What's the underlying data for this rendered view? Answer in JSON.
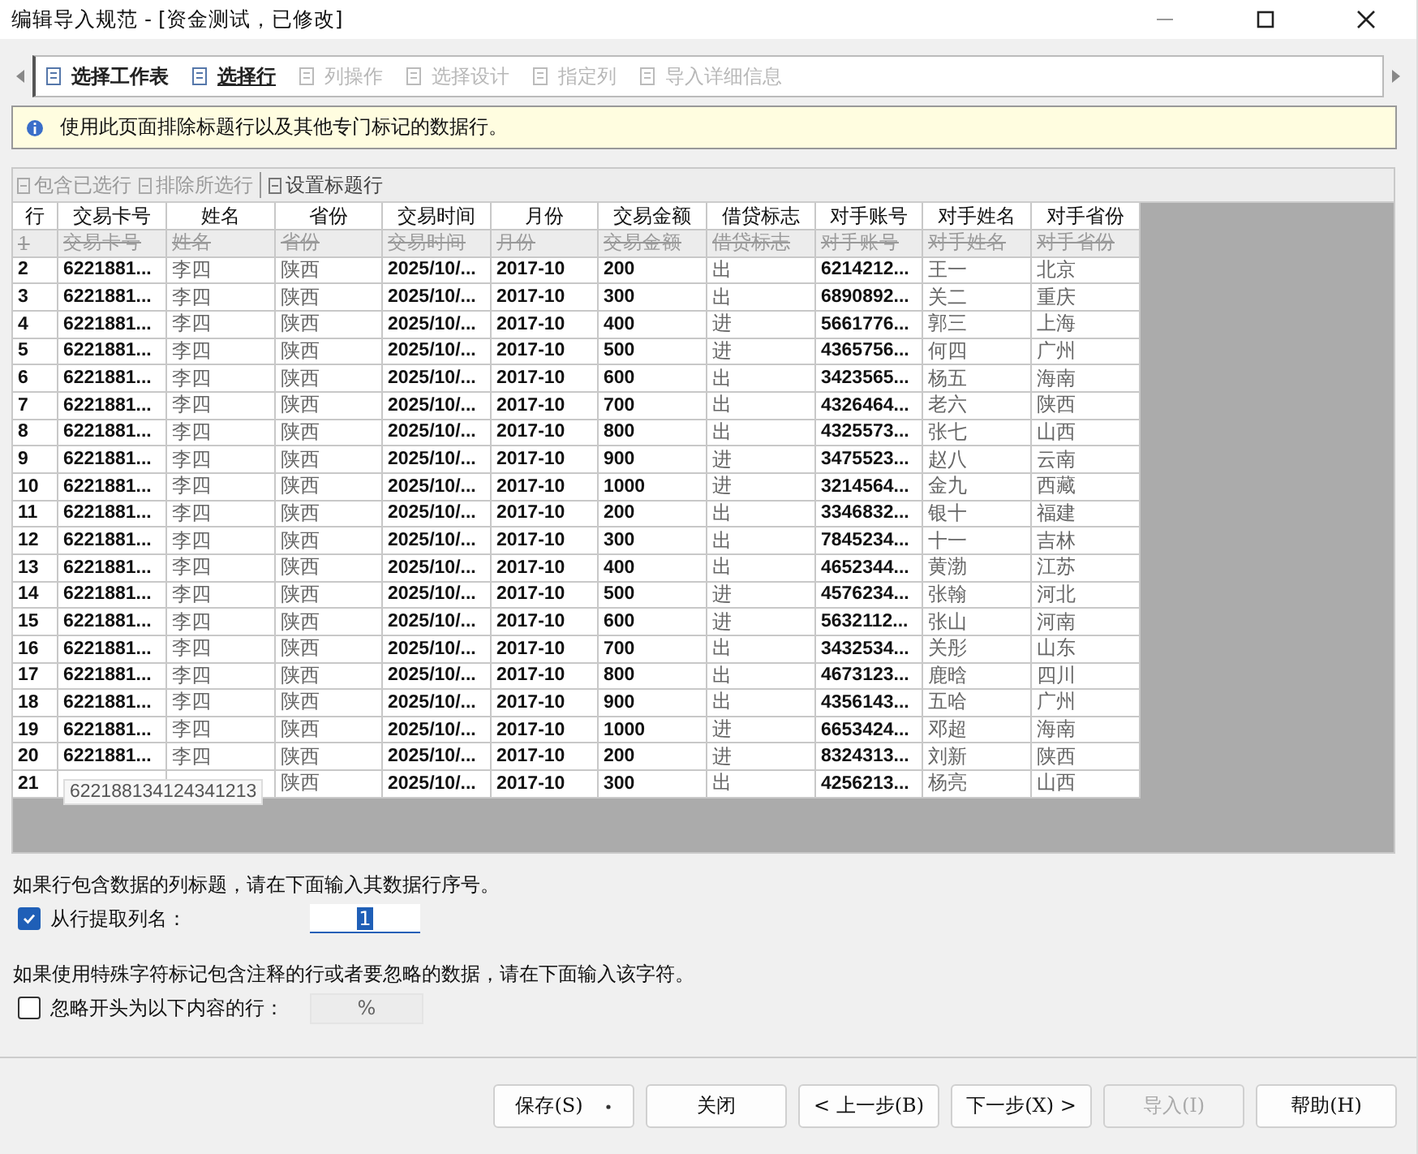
{
  "window": {
    "title": "编辑导入规范 - [资金测试，已修改]"
  },
  "wizard_tabs": [
    {
      "label": "选择工作表",
      "selected": false,
      "disabled": false
    },
    {
      "label": "选择行",
      "selected": true,
      "disabled": false
    },
    {
      "label": "列操作",
      "selected": false,
      "disabled": true
    },
    {
      "label": "选择设计",
      "selected": false,
      "disabled": true
    },
    {
      "label": "指定列",
      "selected": false,
      "disabled": true
    },
    {
      "label": "导入详细信息",
      "selected": false,
      "disabled": true
    }
  ],
  "info_bar": {
    "text": "使用此页面排除标题行以及其他专门标记的数据行。"
  },
  "grid_toolbar": [
    {
      "label": "包含已选行",
      "disabled": true
    },
    {
      "label": "排除所选行",
      "disabled": true
    },
    {
      "label": "设置标题行",
      "disabled": false
    }
  ],
  "table": {
    "columns": [
      {
        "label": "行",
        "kind": "num"
      },
      {
        "label": "交易卡号",
        "kind": "num"
      },
      {
        "label": "姓名",
        "kind": "text"
      },
      {
        "label": "省份",
        "kind": "text"
      },
      {
        "label": "交易时间",
        "kind": "num"
      },
      {
        "label": "月份",
        "kind": "num"
      },
      {
        "label": "交易金额",
        "kind": "num"
      },
      {
        "label": "借贷标志",
        "kind": "text"
      },
      {
        "label": "对手账号",
        "kind": "num"
      },
      {
        "label": "对手姓名",
        "kind": "text"
      },
      {
        "label": "对手省份",
        "kind": "text"
      }
    ],
    "rows": [
      {
        "excluded": true,
        "cells": [
          "1",
          "交易卡号",
          "姓名",
          "省份",
          "交易时间",
          "月份",
          "交易金额",
          "借贷标志",
          "对手账号",
          "对手姓名",
          "对手省份"
        ]
      },
      {
        "excluded": false,
        "cells": [
          "2",
          "6221881...",
          "李四",
          "陕西",
          "2025/10/...",
          "2017-10",
          "200",
          "出",
          "6214212...",
          "王一",
          "北京"
        ]
      },
      {
        "excluded": false,
        "cells": [
          "3",
          "6221881...",
          "李四",
          "陕西",
          "2025/10/...",
          "2017-10",
          "300",
          "出",
          "6890892...",
          "关二",
          "重庆"
        ]
      },
      {
        "excluded": false,
        "cells": [
          "4",
          "6221881...",
          "李四",
          "陕西",
          "2025/10/...",
          "2017-10",
          "400",
          "进",
          "5661776...",
          "郭三",
          "上海"
        ]
      },
      {
        "excluded": false,
        "cells": [
          "5",
          "6221881...",
          "李四",
          "陕西",
          "2025/10/...",
          "2017-10",
          "500",
          "进",
          "4365756...",
          "何四",
          "广州"
        ]
      },
      {
        "excluded": false,
        "cells": [
          "6",
          "6221881...",
          "李四",
          "陕西",
          "2025/10/...",
          "2017-10",
          "600",
          "出",
          "3423565...",
          "杨五",
          "海南"
        ]
      },
      {
        "excluded": false,
        "cells": [
          "7",
          "6221881...",
          "李四",
          "陕西",
          "2025/10/...",
          "2017-10",
          "700",
          "出",
          "4326464...",
          "老六",
          "陕西"
        ]
      },
      {
        "excluded": false,
        "cells": [
          "8",
          "6221881...",
          "李四",
          "陕西",
          "2025/10/...",
          "2017-10",
          "800",
          "出",
          "4325573...",
          "张七",
          "山西"
        ]
      },
      {
        "excluded": false,
        "cells": [
          "9",
          "6221881...",
          "李四",
          "陕西",
          "2025/10/...",
          "2017-10",
          "900",
          "进",
          "3475523...",
          "赵八",
          "云南"
        ]
      },
      {
        "excluded": false,
        "cells": [
          "10",
          "6221881...",
          "李四",
          "陕西",
          "2025/10/...",
          "2017-10",
          "1000",
          "进",
          "3214564...",
          "金九",
          "西藏"
        ]
      },
      {
        "excluded": false,
        "cells": [
          "11",
          "6221881...",
          "李四",
          "陕西",
          "2025/10/...",
          "2017-10",
          "200",
          "出",
          "3346832...",
          "银十",
          "福建"
        ]
      },
      {
        "excluded": false,
        "cells": [
          "12",
          "6221881...",
          "李四",
          "陕西",
          "2025/10/...",
          "2017-10",
          "300",
          "出",
          "7845234...",
          "十一",
          "吉林"
        ]
      },
      {
        "excluded": false,
        "cells": [
          "13",
          "6221881...",
          "李四",
          "陕西",
          "2025/10/...",
          "2017-10",
          "400",
          "出",
          "4652344...",
          "黄渤",
          "江苏"
        ]
      },
      {
        "excluded": false,
        "cells": [
          "14",
          "6221881...",
          "李四",
          "陕西",
          "2025/10/...",
          "2017-10",
          "500",
          "进",
          "4576234...",
          "张翰",
          "河北"
        ]
      },
      {
        "excluded": false,
        "cells": [
          "15",
          "6221881...",
          "李四",
          "陕西",
          "2025/10/...",
          "2017-10",
          "600",
          "进",
          "5632112...",
          "张山",
          "河南"
        ]
      },
      {
        "excluded": false,
        "cells": [
          "16",
          "6221881...",
          "李四",
          "陕西",
          "2025/10/...",
          "2017-10",
          "700",
          "出",
          "3432534...",
          "关彤",
          "山东"
        ]
      },
      {
        "excluded": false,
        "cells": [
          "17",
          "6221881...",
          "李四",
          "陕西",
          "2025/10/...",
          "2017-10",
          "800",
          "出",
          "4673123...",
          "鹿晗",
          "四川"
        ]
      },
      {
        "excluded": false,
        "cells": [
          "18",
          "6221881...",
          "李四",
          "陕西",
          "2025/10/...",
          "2017-10",
          "900",
          "出",
          "4356143...",
          "五哈",
          "广州"
        ]
      },
      {
        "excluded": false,
        "cells": [
          "19",
          "6221881...",
          "李四",
          "陕西",
          "2025/10/...",
          "2017-10",
          "1000",
          "进",
          "6653424...",
          "邓超",
          "海南"
        ]
      },
      {
        "excluded": false,
        "cells": [
          "20",
          "6221881...",
          "李四",
          "陕西",
          "2025/10/...",
          "2017-10",
          "200",
          "进",
          "8324313...",
          "刘新",
          "陕西"
        ]
      },
      {
        "excluded": false,
        "cells": [
          "21",
          null,
          null,
          "陕西",
          "2025/10/...",
          "2017-10",
          "300",
          "出",
          "4256213...",
          "杨亮",
          "山西"
        ]
      }
    ],
    "tooltip": "622188134124341213"
  },
  "header_option": {
    "text": "如果行包含数据的列标题，请在下面输入其数据行序号。",
    "checkbox": {
      "label": "从行提取列名：",
      "checked": true
    },
    "field": {
      "value": "1",
      "disabled": false
    }
  },
  "comment_option": {
    "text": "如果使用特殊字符标记包含注释的行或者要忽略的数据，请在下面输入该字符。",
    "checkbox": {
      "label": "忽略开头为以下内容的行：",
      "checked": false
    },
    "field": {
      "value": "%",
      "disabled": true
    }
  },
  "buttons": [
    {
      "label": "保存(S)",
      "kind": "split",
      "disabled": false
    },
    {
      "label": "关闭",
      "kind": "plain",
      "disabled": false
    },
    {
      "label": "< 上一步(B)",
      "kind": "plain",
      "disabled": false
    },
    {
      "label": "下一步(X) >",
      "kind": "plain",
      "disabled": false
    },
    {
      "label": "导入(I)",
      "kind": "plain",
      "disabled": true
    },
    {
      "label": "帮助(H)",
      "kind": "plain",
      "disabled": false
    }
  ]
}
